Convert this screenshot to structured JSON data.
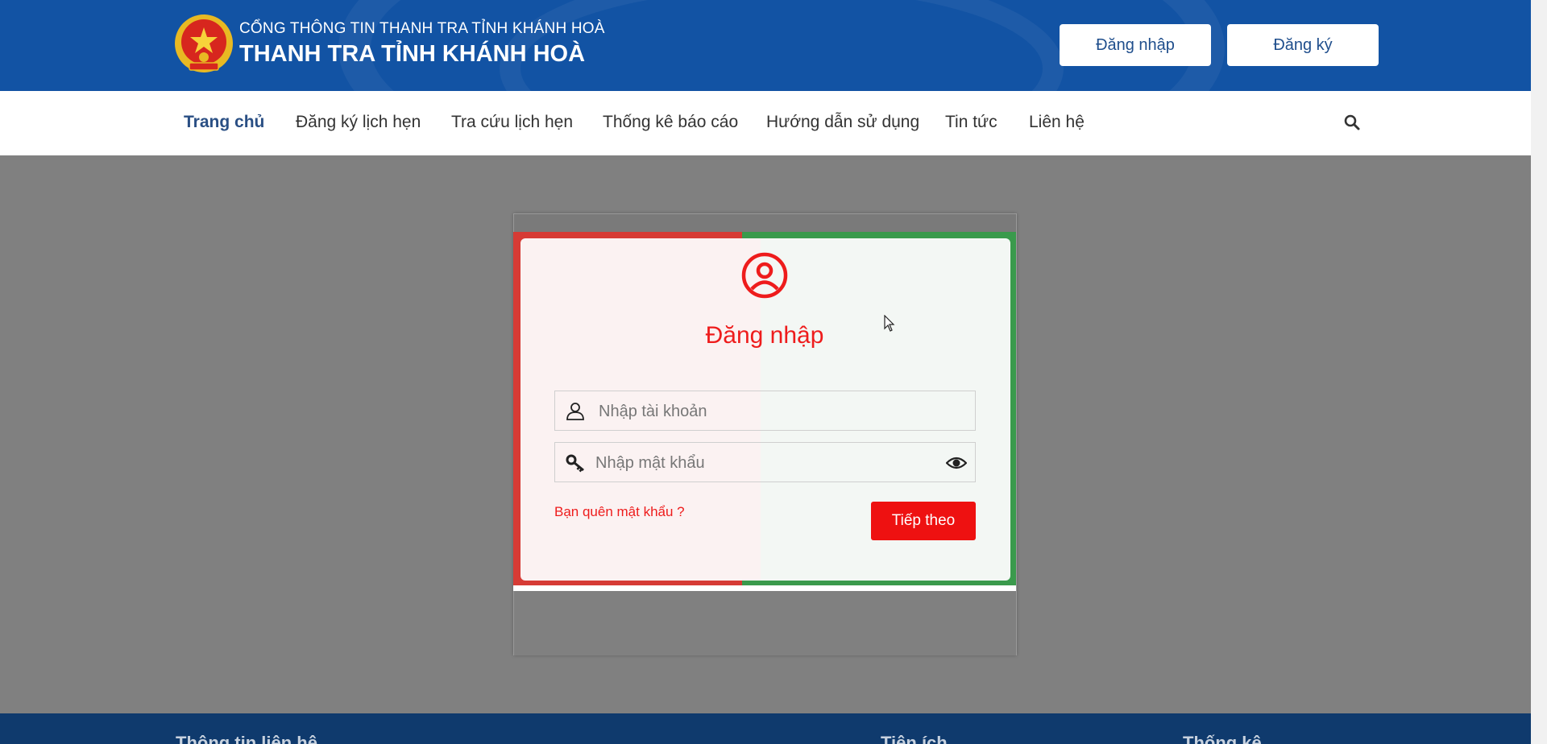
{
  "header": {
    "subtitle": "CỔNG THÔNG TIN THANH TRA TỈNH KHÁNH HOÀ",
    "title": "THANH TRA TỈNH KHÁNH HOÀ",
    "login_label": "Đăng nhập",
    "register_label": "Đăng ký",
    "bg_color": "#1253a4"
  },
  "nav": {
    "items": [
      {
        "label": "Trang chủ",
        "active": true
      },
      {
        "label": "Đăng ký lịch hẹn"
      },
      {
        "label": "Tra cứu lịch hẹn"
      },
      {
        "label": "Thống kê báo cáo"
      },
      {
        "label": "Hướng dẫn sử dụng"
      },
      {
        "label": "Tin tức"
      },
      {
        "label": "Liên hệ"
      }
    ],
    "search_icon": "search-icon"
  },
  "login": {
    "title": "Đăng nhập",
    "username_placeholder": "Nhập tài khoản",
    "password_placeholder": "Nhập mật khẩu",
    "forgot_label": "Bạn quên mật khẩu ?",
    "next_label": "Tiếp theo",
    "accent_color": "#ee1c1c"
  },
  "footer": {
    "headings": [
      "Thông tin liên hệ",
      "Tiện ích",
      "Thống kê"
    ]
  }
}
